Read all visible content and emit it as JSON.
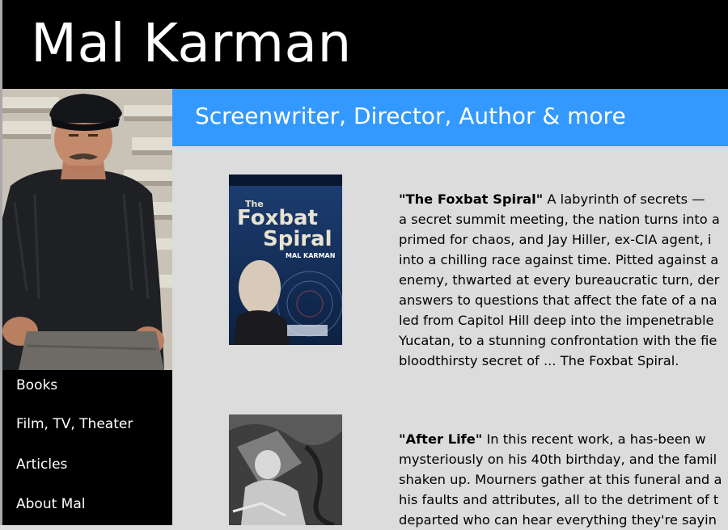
{
  "header": {
    "title": "Mal Karman"
  },
  "tagline": "Screenwriter, Director, Author & more",
  "nav": {
    "items": [
      {
        "label": "Books"
      },
      {
        "label": "Film, TV, Theater"
      },
      {
        "label": "Articles"
      },
      {
        "label": "About Mal"
      }
    ]
  },
  "books": [
    {
      "title": "\"The Foxbat Spiral\"",
      "cover": {
        "title_line1": "The",
        "title_line2": "Foxbat",
        "title_line3": "Spiral",
        "author": "MAL KARMAN"
      },
      "lines": [
        "A labyrinth of secrets —",
        "a secret summit meeting, the nation turns into a",
        "primed for chaos, and Jay Hiller, ex-CIA agent, i",
        "into a chilling race against time. Pitted against a",
        "enemy, thwarted at every bureaucratic turn, der",
        "answers to questions that affect the fate of a na",
        "led from Capitol Hill deep into the impenetrable",
        "Yucatan, to a stunning confrontation with the fie",
        "bloodthirsty secret of ... The Foxbat Spiral."
      ]
    },
    {
      "title": "\"After Life\"",
      "lines": [
        "In this recent work, a has-been w",
        "mysteriously on his 40th birthday, and the famil",
        "shaken up. Mourners gather at this funeral and a",
        "his faults and attributes, all to the detriment of t",
        "departed who can hear everything they're sayin"
      ]
    }
  ],
  "colors": {
    "header_bg": "#000000",
    "tagline_bg": "#3399ff",
    "content_bg": "#dcdcdc"
  }
}
